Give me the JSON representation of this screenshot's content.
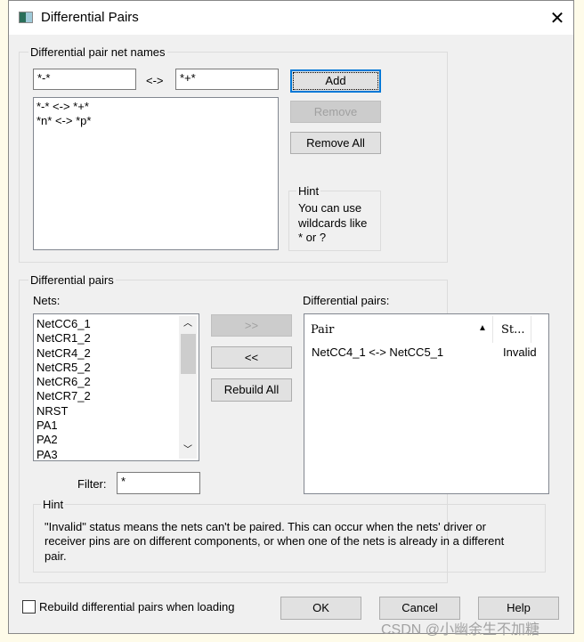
{
  "window": {
    "title": "Differential Pairs"
  },
  "net_names_group": {
    "label": "Differential pair net names",
    "left_value": "*-*",
    "separator": "<->",
    "right_value": "*+*",
    "patterns": [
      "*-* <-> *+*",
      "*n* <-> *p*"
    ],
    "add": "Add",
    "remove": "Remove",
    "remove_all": "Remove All",
    "hint_label": "Hint",
    "hint_lines": [
      "You can use",
      "wildcards like",
      "* or ?"
    ]
  },
  "pairs_group": {
    "label": "Differential pairs",
    "nets_label": "Nets:",
    "nets": [
      "NetCC6_1",
      "NetCR1_2",
      "NetCR4_2",
      "NetCR5_2",
      "NetCR6_2",
      "NetCR7_2",
      "NRST",
      "PA1",
      "PA2",
      "PA3"
    ],
    "move_right": ">>",
    "move_left": "<<",
    "rebuild_all": "Rebuild All",
    "filter_label": "Filter:",
    "filter_value": "*",
    "pairs_label": "Differential pairs:",
    "columns": [
      "Pair",
      "St..."
    ],
    "rows": [
      {
        "pair": "NetCC4_1 <-> NetCC5_1",
        "status": "Invalid"
      }
    ],
    "hint_label": "Hint",
    "hint_lines": [
      "\"Invalid\" status means the nets can't be paired. This can occur when the nets' driver or",
      "receiver pins are on different components, or when one of the nets is already in a different",
      "pair."
    ]
  },
  "footer": {
    "rebuild_checkbox": "Rebuild differential pairs when loading",
    "rebuild_checked": false,
    "ok": "OK",
    "cancel": "Cancel",
    "help": "Help"
  },
  "watermark": "CSDN @小幽余生不加糖"
}
